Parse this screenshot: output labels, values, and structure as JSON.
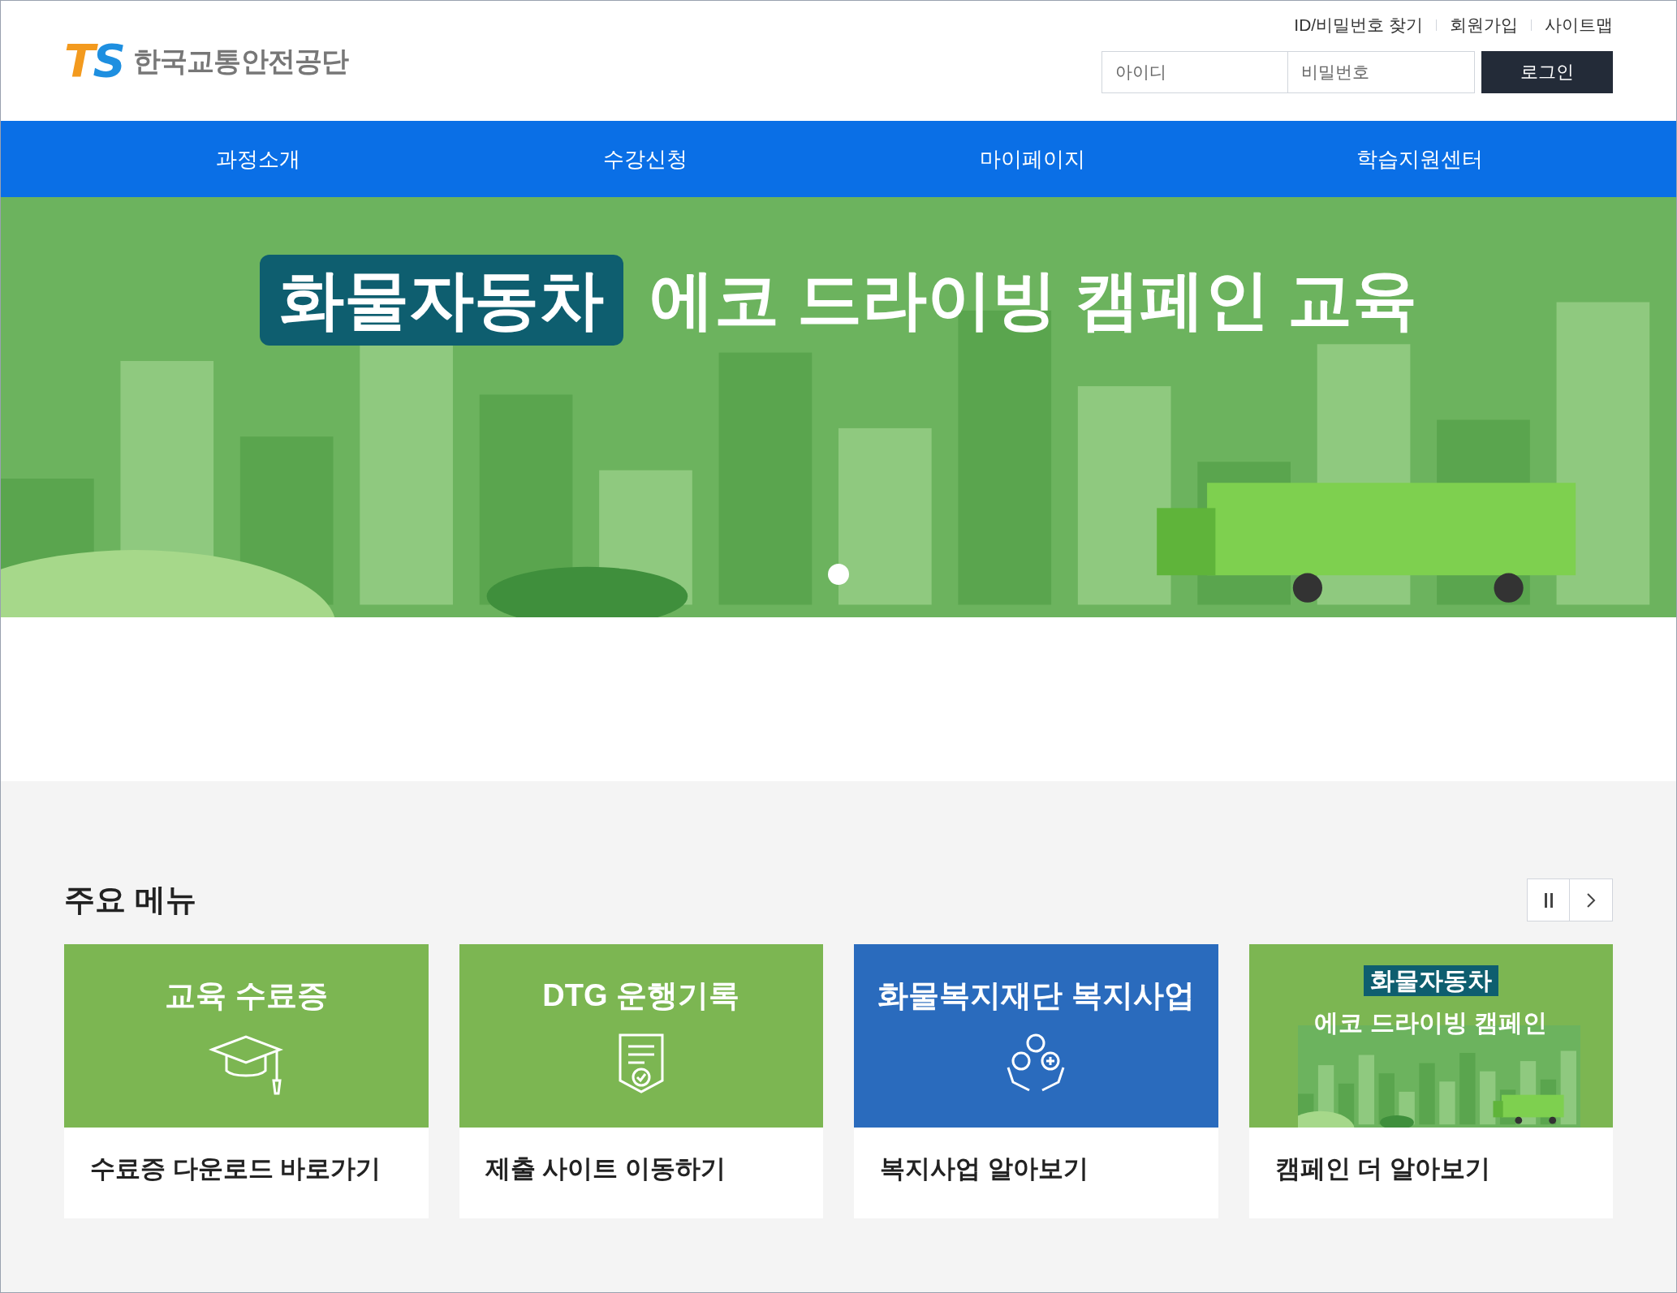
{
  "logo": {
    "mark": "TS",
    "name": "한국교통안전공단"
  },
  "top_links": [
    {
      "label": "ID/비밀번호 찾기"
    },
    {
      "label": "회원가입"
    },
    {
      "label": "사이트맵"
    }
  ],
  "login": {
    "id_placeholder": "아이디",
    "password_placeholder": "비밀번호",
    "button": "로그인"
  },
  "nav": [
    {
      "label": "과정소개"
    },
    {
      "label": "수강신청"
    },
    {
      "label": "마이페이지"
    },
    {
      "label": "학습지원센터"
    }
  ],
  "banner": {
    "tag": "화물자동차",
    "headline": "에코 드라이빙 캠페인 교육",
    "dots": [
      {
        "selected": true
      }
    ]
  },
  "main_menu": {
    "title": "주요 메뉴",
    "paused": false,
    "cards": [
      {
        "kind": "cap",
        "color": "#7cb652",
        "title": "교육 수료증",
        "link": "수료증 다운로드 바로가기"
      },
      {
        "kind": "document",
        "color": "#7cb652",
        "title": "DTG 운행기록",
        "link": "제출 사이트 이동하기"
      },
      {
        "kind": "hands",
        "color": "#2a6bbd",
        "title": "화물복지재단 복지사업",
        "link": "복지사업 알아보기"
      },
      {
        "kind": "picture",
        "color": "#7cb652",
        "tag": "화물자동차",
        "title": "에코 드라이빙 캠페인",
        "link": "캠페인 더 알아보기"
      }
    ]
  }
}
